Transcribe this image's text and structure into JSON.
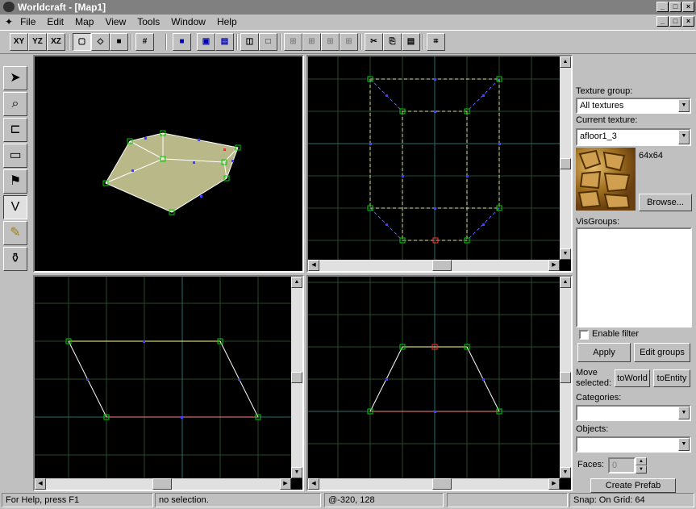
{
  "window": {
    "title": "Worldcraft - [Map1]"
  },
  "menu": [
    "File",
    "Edit",
    "Map",
    "View",
    "Tools",
    "Window",
    "Help"
  ],
  "toolbar": {
    "xy": "XY",
    "yz": "YZ",
    "xz": "XZ"
  },
  "panel": {
    "texture_group_label": "Texture group:",
    "texture_group_value": "All textures",
    "current_texture_label": "Current texture:",
    "current_texture_value": "afloor1_3",
    "texture_size": "64x64",
    "browse_label": "Browse...",
    "visgroups_label": "VisGroups:",
    "enable_filter_label": "Enable filter",
    "apply_label": "Apply",
    "edit_groups_label": "Edit groups",
    "move_selected_label_1": "Move",
    "move_selected_label_2": "selected:",
    "to_world_label": "toWorld",
    "to_entity_label": "toEntity",
    "categories_label": "Categories:",
    "categories_value": "",
    "objects_label": "Objects:",
    "objects_value": "",
    "faces_label": "Faces:",
    "faces_value": "0",
    "create_prefab_label": "Create Prefab"
  },
  "status": {
    "help": "For Help, press F1",
    "selection": "no selection.",
    "coords": "@-320, 128",
    "snap": "Snap: On Grid: 64"
  },
  "colors": {
    "grid": "#3a5a3a",
    "grid_major": "#2e7a7a",
    "vertex": "#00c000",
    "handle": "#0000ff",
    "selected_edge": "#ffff80"
  }
}
